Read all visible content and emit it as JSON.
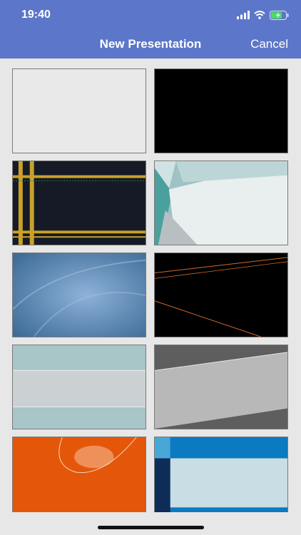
{
  "status_bar": {
    "time": "19:40",
    "icons": [
      "cellular-signal-icon",
      "wifi-icon",
      "battery-charging-icon"
    ]
  },
  "nav": {
    "title": "New Presentation",
    "cancel_label": "Cancel"
  },
  "templates": [
    "blank-white",
    "blank-black",
    "plaid-gold",
    "teal-facets",
    "blue-swirl",
    "black-orange-lines",
    "teal-bands",
    "gray-diagonal-band",
    "orange-globe",
    "blue-frame"
  ],
  "colors": {
    "header": "#5c77c9",
    "background": "#e6e7e6"
  }
}
